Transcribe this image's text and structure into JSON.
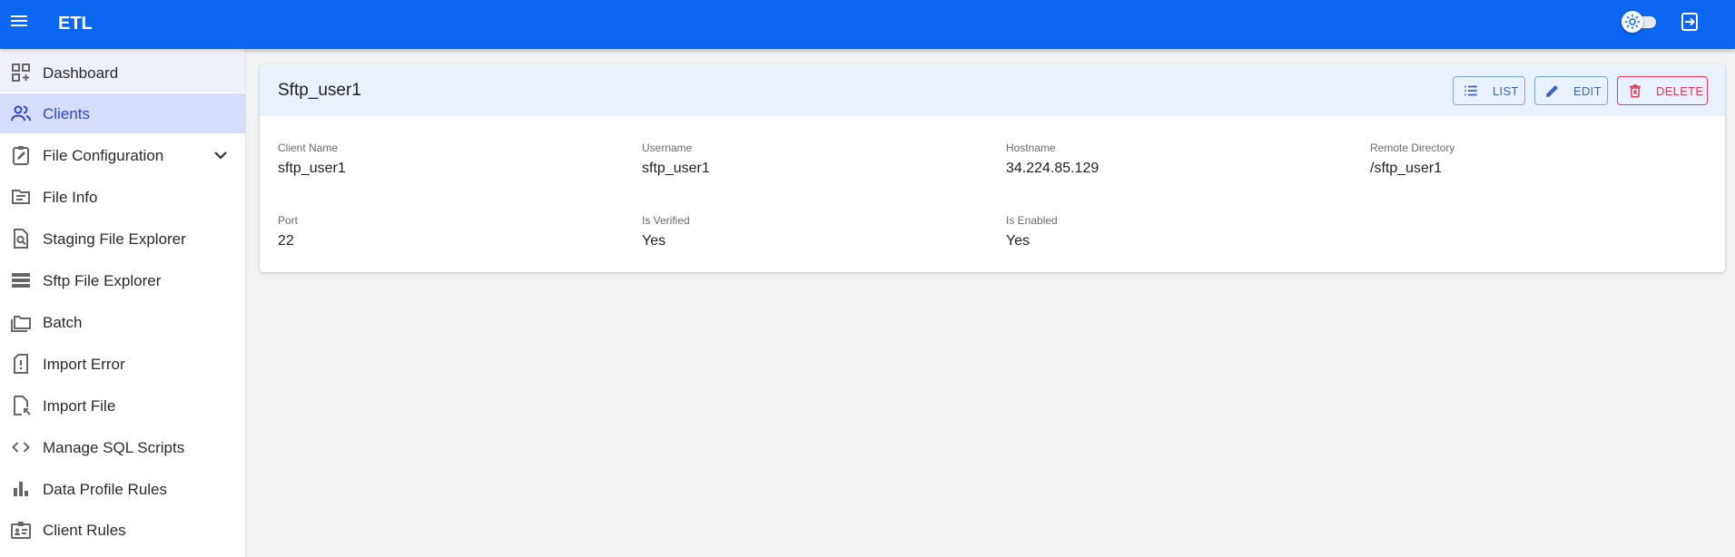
{
  "app": {
    "title": "ETL"
  },
  "sidebar": {
    "items": [
      {
        "label": "Dashboard",
        "icon": "dashboard-icon"
      },
      {
        "label": "Clients",
        "icon": "people-icon",
        "active": true
      },
      {
        "label": "File Configuration",
        "icon": "clipboard-edit-icon",
        "expandable": true
      },
      {
        "label": "File Info",
        "icon": "file-info-icon"
      },
      {
        "label": "Staging File Explorer",
        "icon": "file-search-icon"
      },
      {
        "label": "Sftp File Explorer",
        "icon": "list-icon"
      },
      {
        "label": "Batch",
        "icon": "folders-icon"
      },
      {
        "label": "Import Error",
        "icon": "file-alert-icon"
      },
      {
        "label": "Import File",
        "icon": "file-import-icon"
      },
      {
        "label": "Manage SQL Scripts",
        "icon": "code-icon"
      },
      {
        "label": "Data Profile Rules",
        "icon": "bar-chart-icon"
      },
      {
        "label": "Client Rules",
        "icon": "badge-icon"
      }
    ]
  },
  "detail": {
    "title": "Sftp_user1",
    "buttons": {
      "list": "LIST",
      "edit": "EDIT",
      "delete": "DELETE"
    },
    "fields": [
      {
        "label": "Client Name",
        "value": "sftp_user1"
      },
      {
        "label": "Username",
        "value": "sftp_user1"
      },
      {
        "label": "Hostname",
        "value": "34.224.85.129"
      },
      {
        "label": "Remote Directory",
        "value": "/sftp_user1"
      },
      {
        "label": "Port",
        "value": "22"
      },
      {
        "label": "Is Verified",
        "value": "Yes"
      },
      {
        "label": "Is Enabled",
        "value": "Yes"
      }
    ]
  },
  "colors": {
    "appbar": "#0b66f2",
    "active_nav_bg": "#d6dcfb",
    "active_nav_text": "#2f49c9",
    "card_header_bg": "#e9f1fc",
    "primary_outline": "#3a63c5",
    "danger": "#e0395a"
  }
}
